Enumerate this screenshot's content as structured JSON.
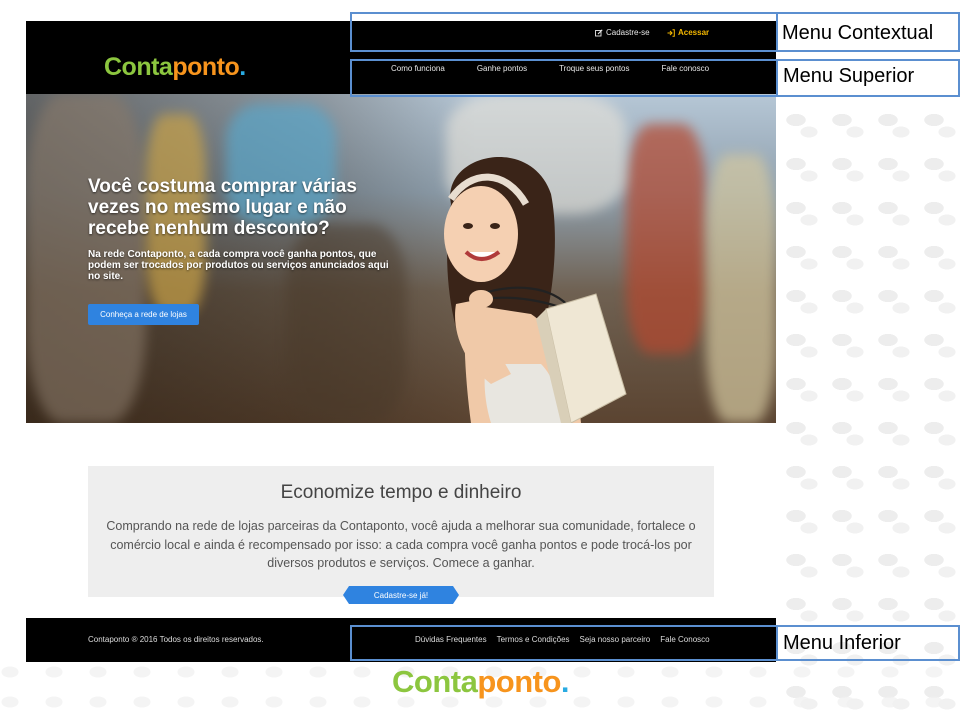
{
  "site": {
    "logo": {
      "part1": "Conta",
      "part2": "ponto",
      "dot": "."
    },
    "topbar": {
      "signup": {
        "icon": "edit-icon",
        "label": "Cadastre-se"
      },
      "login": {
        "icon": "sign-in-icon",
        "label": "Acessar"
      }
    },
    "nav": [
      "Como funciona",
      "Ganhe pontos",
      "Troque seus pontos",
      "Fale conosco"
    ],
    "hero": {
      "headline": "Você costuma comprar várias vezes no mesmo lugar e não recebe nenhum desconto?",
      "subtext": "Na rede Contaponto, a cada compra você ganha pontos, que podem ser trocados por produtos ou serviços anunciados aqui no site.",
      "cta": "Conheça a rede de lojas"
    },
    "info": {
      "title": "Economize tempo e dinheiro",
      "text": "Comprando na rede de lojas parceiras da Contaponto, você ajuda a melhorar sua comunidade, fortalece o comércio local e ainda é recompensado por isso: a cada compra você ganha pontos e pode trocá-los por diversos produtos e serviços. Comece a ganhar.",
      "signup_ribbon": "Cadastre-se já!"
    },
    "footer": {
      "copyright": "Contaponto ® 2016 Todos os direitos reservados.",
      "links": [
        "Dúvidas Frequentes",
        "Termos e Condições",
        "Seja nosso parceiro",
        "Fale Conosco"
      ]
    }
  },
  "annotations": {
    "contextual": "Menu Contextual",
    "superior": "Menu Superior",
    "inferior": "Menu Inferior"
  },
  "colors": {
    "logo_green": "#8cc63f",
    "logo_orange": "#f7941d",
    "logo_blue": "#29abe2",
    "accent_blue": "#2f83e0",
    "login_yellow": "#f5b800",
    "annotation_border": "#5b8fd0"
  }
}
